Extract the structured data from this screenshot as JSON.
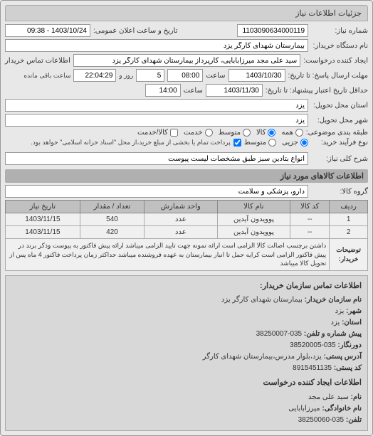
{
  "tab": {
    "title": "جزئیات اطلاعات نیاز"
  },
  "fields": {
    "request_no_label": "شماره نیاز:",
    "request_no": "1103090634000119",
    "announce_label": "تاریخ و ساعت اعلان عمومی:",
    "announce_value": "1403/10/24 - 09:38",
    "buyer_name_label": "نام دستگاه خریدار:",
    "buyer_name": "بیمارستان شهدای کارگر یزد",
    "requester_label": "ایجاد کننده درخواست:",
    "requester": "سید علی مجد میرزابابایی، کارپرداز بیمارستان شهدای کارگر یزد",
    "contact_info_label": "اطلاعات تماس خریدار",
    "deadline_label": "مهلت ارسال پاسخ: تا تاریخ:",
    "deadline_date": "1403/10/30",
    "deadline_time_label": "ساعت",
    "deadline_time": "08:00",
    "remaining_label": "",
    "remaining_days": "5",
    "remaining_day_label": "روز و",
    "remaining_time": "22:04:29",
    "remaining_after_label": "ساعت باقی مانده",
    "min_deadline_label": "حداقل تاریخ اعتبار پیشنهاد: تا تاریخ:",
    "min_deadline_date": "1403/11/30",
    "min_deadline_time_label": "ساعت",
    "min_deadline_time": "14:00",
    "delivery_province_label": "استان محل تحویل:",
    "delivery_province": "یزد",
    "delivery_city_label": "شهر محل تحویل:",
    "delivery_city": "یزد",
    "budget_label": "طبقه بندی موضوعی:",
    "radio_all": "همه",
    "radio_goods": "کالا",
    "radio_mid": "متوسط",
    "radio_service": "خدمت",
    "check_cash": "کالا/خدمت",
    "purchase_type_label": "نوع فرآیند خرید:",
    "radio_cash": "جزیی",
    "radio_mid2": "متوسط",
    "purchase_note": "پرداخت تمام یا بخشی از مبلغ خرید،از محل \"اسناد خزانه اسلامی\" خواهد بود.",
    "general_desc_label": "شرح کلی نیاز:",
    "general_desc": "انواع بتادین سبز طبق مشخصات لیست پیوست",
    "goods_info_header": "اطلاعات کالاهای مورد نیاز",
    "goods_group_label": "گروه کالا:",
    "goods_group": "دارو، پزشکی و سلامت"
  },
  "table": {
    "headers": {
      "row": "ردیف",
      "code": "کد کالا",
      "name": "نام کالا",
      "unit": "واحد شمارش",
      "qty": "تعداد / مقدار",
      "date": "تاریخ نیاز"
    },
    "rows": [
      {
        "row": "1",
        "code": "--",
        "name": "پوویدون آیدین",
        "unit": "عدد",
        "qty": "540",
        "date": "1403/11/15"
      },
      {
        "row": "2",
        "code": "--",
        "name": "پوویدون آیدین",
        "unit": "عدد",
        "qty": "420",
        "date": "1403/11/15"
      }
    ],
    "buyer_desc_label": "توضیحات خریدار:",
    "buyer_desc": "داشتن برچسب اصالت کالا الزامی است ارائه نمونه جهت تایید الزامی میباشد ارائه پیش فاکتور به پیوست وذکر برند در پیش فاکتور الزامی است کرایه حمل تا انبار بیمارستان به عهده فروشنده میباشد حداکثر زمان پرداخت فاکتور 4 ماه پس از تحویل کالا میباشد"
  },
  "contact": {
    "header": "اطلاعات تماس سازمان خریدار:",
    "org_label": "نام سازمان خریدار:",
    "org": "بیمارستان شهدای کارگر یزد",
    "city_label": "شهر:",
    "city": "یزد",
    "province_label": "استان:",
    "province": "یزد",
    "phone_label": "پیش شماره و تلفن:",
    "phone": "035-38250007",
    "fax_label": "دورنگار:",
    "fax": "035-38520005",
    "postal_label": "آدرس پستی:",
    "postal": "یزد،بلوار مدرس،بیمارستان شهدای کارگر",
    "zip_label": "کد پستی:",
    "zip": "8915451135",
    "creator_header": "اطلاعات ایجاد کننده درخواست",
    "name_label": "نام:",
    "name": "سید علی مجد",
    "family_label": "نام خانوادگی:",
    "family": "میرزابابایی",
    "tel_label": "تلفن:",
    "tel": "035-38250060"
  }
}
